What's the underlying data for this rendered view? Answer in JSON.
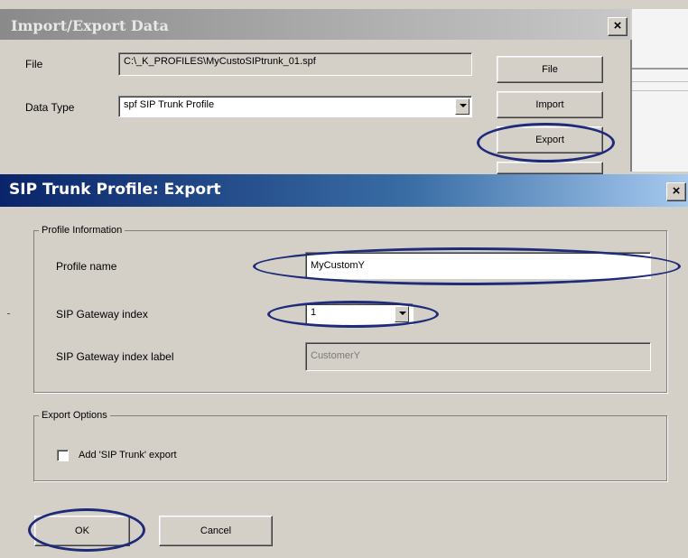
{
  "background_dialog": {
    "title": "Import/Export Data",
    "close_label": "×",
    "file_label": "File",
    "file_path": "C:\\_K_PROFILES\\MyCustoSIPtrunk_01.spf",
    "data_type_label": "Data Type",
    "data_type_value": "spf  SIP Trunk Profile",
    "buttons": {
      "file": "File",
      "import": "Import",
      "export": "Export"
    }
  },
  "export_dialog": {
    "title": "SIP Trunk Profile: Export",
    "close_label": "×",
    "profile_info": {
      "legend": "Profile Information",
      "profile_name_label": "Profile name",
      "profile_name_value": "MyCustomY",
      "gateway_index_label": "SIP Gateway index",
      "gateway_index_value": "1",
      "gateway_index_label_label": "SIP Gateway index label",
      "gateway_index_label_value": "CustomerY"
    },
    "export_options": {
      "legend": "Export Options",
      "add_sip_trunk_label": "Add 'SIP Trunk' export",
      "add_sip_trunk_checked": false
    },
    "buttons": {
      "ok": "OK",
      "cancel": "Cancel"
    }
  },
  "annotation_color": "#1e2a7a"
}
